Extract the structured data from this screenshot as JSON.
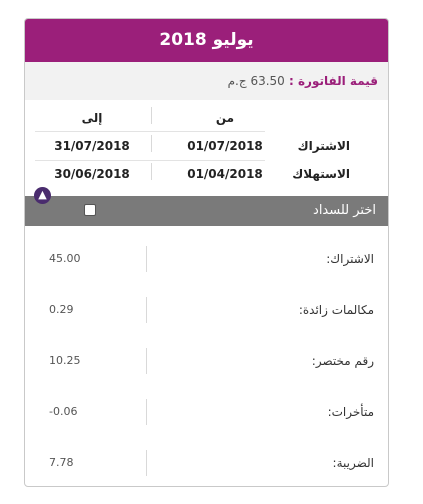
{
  "bill": {
    "title": "يوليو 2018",
    "amount_label": "قيمة الفاتورة :",
    "amount_value": "63.50 ج.م",
    "columns": {
      "from": "من",
      "to": "إلى"
    },
    "rows": [
      {
        "label": "الاشتراك",
        "from": "01/07/2018",
        "to": "31/07/2018"
      },
      {
        "label": "الاستهلاك",
        "from": "01/04/2018",
        "to": "30/06/2018"
      }
    ],
    "pay_label": "اختر للسداد",
    "pay_checked": false,
    "collapse_icon": "chevron-up-icon"
  },
  "details": [
    {
      "label": "الاشتراك:",
      "value": "45.00"
    },
    {
      "label": "مكالمات زائدة:",
      "value": "0.29"
    },
    {
      "label": "رقم مختصر:",
      "value": "10.25"
    },
    {
      "label": "متأخرات:",
      "value": "-0.06"
    },
    {
      "label": "الضريبة:",
      "value": "7.78"
    }
  ],
  "colors": {
    "brand": "#9b1f7a",
    "pay_bar": "#7a7a7a",
    "toggle": "#4a2c6e"
  }
}
